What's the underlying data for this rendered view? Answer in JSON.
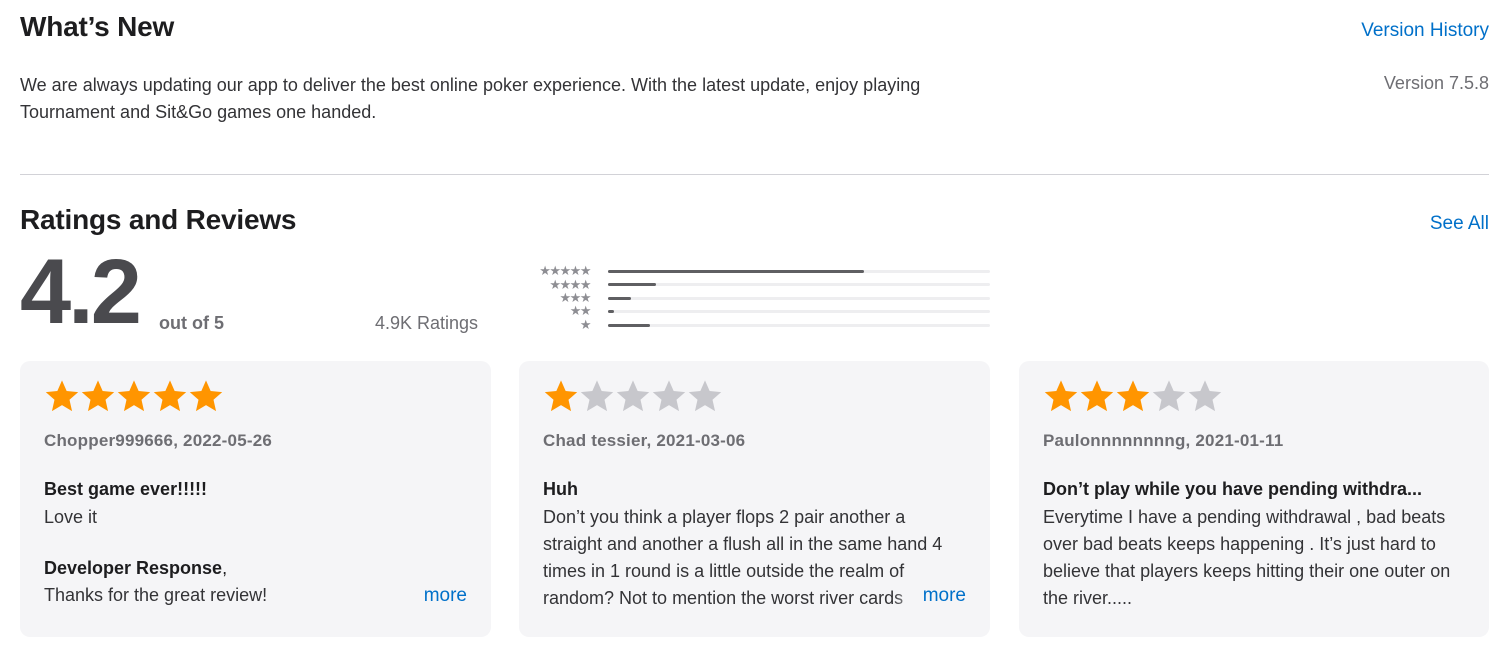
{
  "whats_new": {
    "title": "What’s New",
    "version_history_label": "Version History",
    "release_notes": "We are always updating our app to deliver the best online poker experience. With the latest update, enjoy playing Tournament and Sit&Go games one handed.",
    "version": "Version 7.5.8"
  },
  "ratings": {
    "title": "Ratings and Reviews",
    "see_all_label": "See All",
    "average": "4.2",
    "out_of": "out of 5",
    "count": "4.9K Ratings",
    "star_color": "#ff9500",
    "empty_star_color": "#c7c7cc",
    "histogram": [
      {
        "stars": 5,
        "label": "★★★★★",
        "fraction": 0.67
      },
      {
        "stars": 4,
        "label": "★★★★",
        "fraction": 0.126
      },
      {
        "stars": 3,
        "label": "★★★",
        "fraction": 0.06
      },
      {
        "stars": 2,
        "label": "★★",
        "fraction": 0.016
      },
      {
        "stars": 1,
        "label": "★",
        "fraction": 0.11
      }
    ]
  },
  "reviews": [
    {
      "rating": 5,
      "meta": "Chopper999666, 2022-05-26",
      "title": "Best game ever!!!!!",
      "body": "Love it",
      "developer_response_label": "Developer Response",
      "developer_response_suffix": ",",
      "developer_response": "Thanks for the great review!",
      "more_label": "more"
    },
    {
      "rating": 1,
      "meta": "Chad tessier, 2021-03-06",
      "title": "Huh",
      "body": "Don’t you think a player flops 2 pair another a straight and another a flush all in the same hand 4 times in 1 round is a little outside the realm of random? Not to mention the worst river cards",
      "more_label": "more"
    },
    {
      "rating": 3,
      "meta": "Paulonnnnnnnng, 2021-01-11",
      "title": "Don’t play while you have pending withdra...",
      "body": "Everytime I have a pending withdrawal , bad beats over bad beats keeps happening . It’s just hard to believe that players keeps hitting their one outer on the river....."
    }
  ]
}
